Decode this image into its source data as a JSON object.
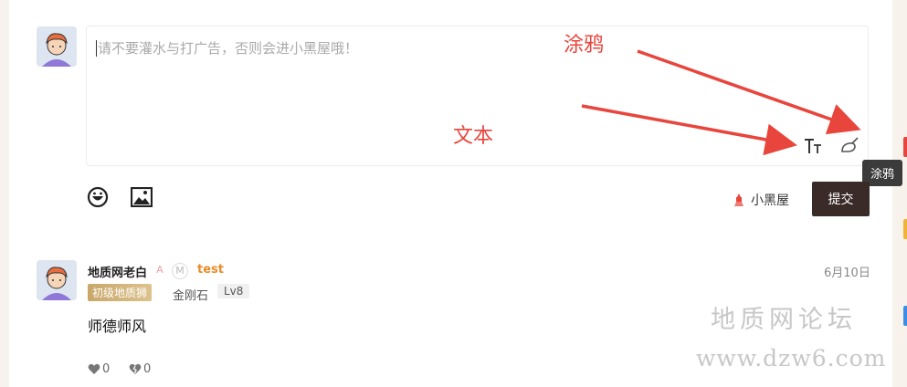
{
  "editor": {
    "placeholder": "请不要灌水与打广告，否则会进小黑屋哦！",
    "tools": {
      "text_icon": "text-format-icon",
      "doodle_icon": "doodle-brush-icon"
    },
    "tooltip": "涂鸦"
  },
  "annotations": {
    "doodle": "涂鸦",
    "text": "文本",
    "arrow_color": "#e8453c"
  },
  "toolbar": {
    "emoji_icon": "emoji-icon",
    "image_icon": "image-icon",
    "blacklist_label": "小黑屋",
    "submit_label": "提交"
  },
  "comment": {
    "username": "地质网老白",
    "badge_a": "A",
    "badge_m": "M",
    "tag": "test",
    "date": "6月10日",
    "title_badge": "初级地质狮",
    "mineral": "金刚石",
    "level": "Lv8",
    "content": "师德师风",
    "likes": "0",
    "dislikes": "0"
  },
  "watermark": {
    "line1": "地质网论坛",
    "line2": "www.dzw6.com"
  },
  "colors": {
    "accent": "#3a2a28",
    "annotation": "#e8453c",
    "username_tag": "#e88a2a"
  }
}
